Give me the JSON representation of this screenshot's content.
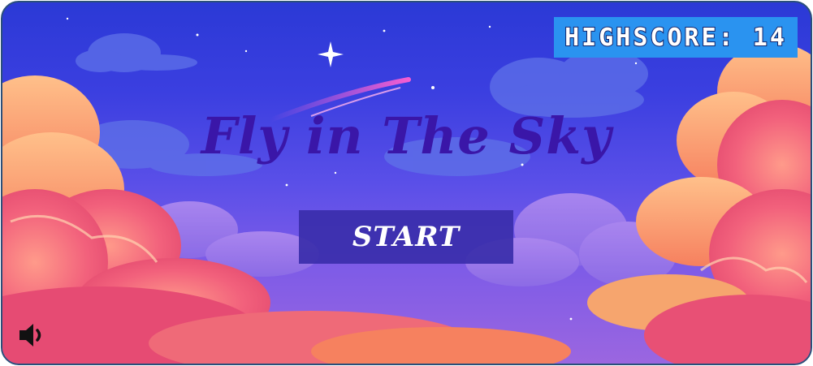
{
  "game": {
    "title": "Fly in The Sky",
    "highscore_label": "HIGHSCORE: 14",
    "start_label": "START"
  },
  "icons": {
    "sound": "speaker-icon"
  },
  "colors": {
    "sky_top": "#2b39d6",
    "sky_bottom": "#9b66e0",
    "title": "#3a16a8",
    "start_bg": "#3a2eaa",
    "highscore_bg": "#2a93f0",
    "cloud_pink": "#f1607a",
    "cloud_orange": "#f7a36b"
  }
}
